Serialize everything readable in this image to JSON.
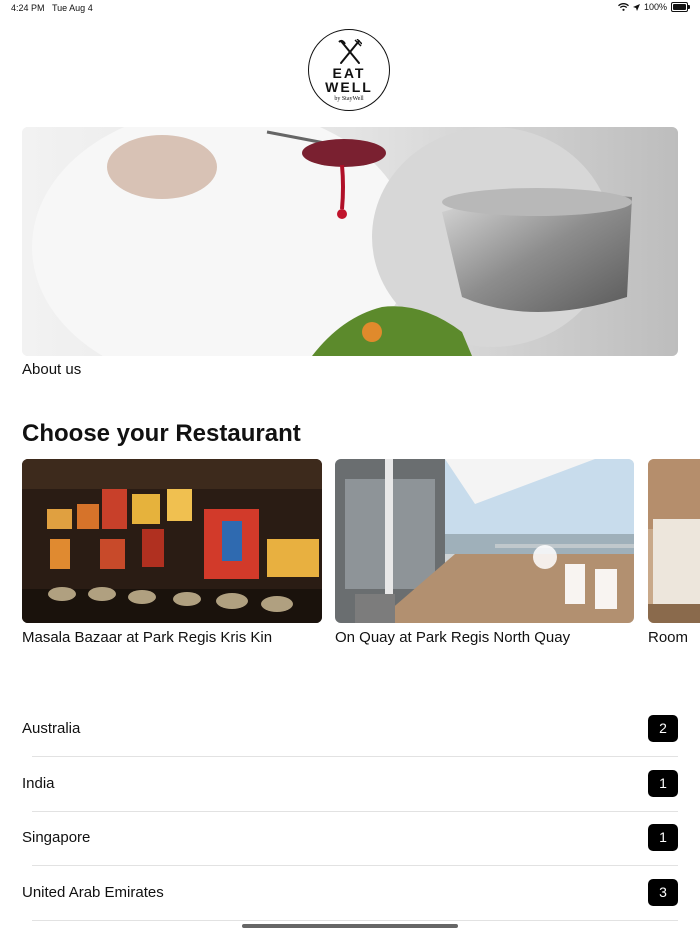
{
  "status_bar": {
    "time": "4:24 PM",
    "date": "Tue Aug 4",
    "battery": "100%",
    "battery_level": 1.0
  },
  "logo": {
    "line1": "EAT",
    "line2": "WELL",
    "tagline": "by StayWell"
  },
  "about_label": "About us",
  "restaurants_title": "Choose your Restaurant",
  "restaurants": [
    {
      "name": "Masala Bazaar at Park Regis Kris Kin"
    },
    {
      "name": "On Quay at Park Regis North Quay"
    },
    {
      "name": "Room"
    }
  ],
  "countries": [
    {
      "name": "Australia",
      "count": "2"
    },
    {
      "name": "India",
      "count": "1"
    },
    {
      "name": "Singapore",
      "count": "1"
    },
    {
      "name": "United Arab Emirates",
      "count": "3"
    }
  ]
}
